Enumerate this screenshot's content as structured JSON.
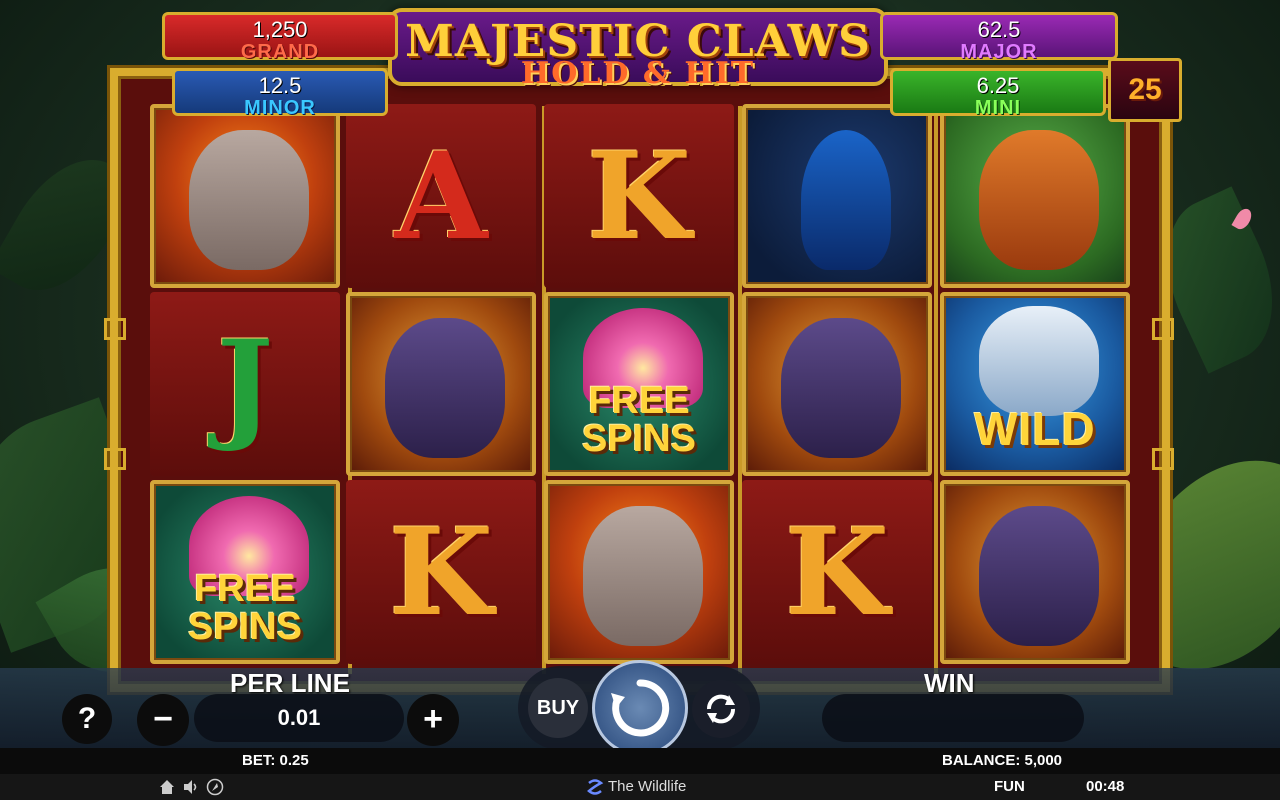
{
  "game": {
    "title": "MAJESTIC CLAWS",
    "subtitle": "HOLD & HIT",
    "lines": "25"
  },
  "jackpots": {
    "grand": {
      "amount": "1,250",
      "label": "GRAND"
    },
    "minor": {
      "amount": "12.5",
      "label": "MINOR"
    },
    "major": {
      "amount": "62.5",
      "label": "MAJOR"
    },
    "mini": {
      "amount": "6.25",
      "label": "MINI"
    }
  },
  "reels": [
    [
      "elephant",
      "J",
      "free-spins"
    ],
    [
      "A",
      "bear",
      "K"
    ],
    [
      "K",
      "free-spins",
      "elephant"
    ],
    [
      "peacock",
      "bear",
      "K"
    ],
    [
      "red-panda",
      "wild-tiger",
      "bear"
    ]
  ],
  "symbols": {
    "wild": "WILD",
    "free_line1": "FREE",
    "free_line2": "SPINS",
    "letter_a": "A",
    "letter_k": "K",
    "letter_j": "J"
  },
  "controls": {
    "per_line_label": "PER LINE",
    "per_line_value": "0.01",
    "win_label": "WIN",
    "buy_label": "BUY",
    "help_label": "?",
    "minus_label": "−",
    "plus_label": "+"
  },
  "status": {
    "bet": "BET: 0.25",
    "balance": "BALANCE: 5,000",
    "mode": "FUN",
    "clock": "00:48",
    "brand": "The Wildlife"
  },
  "icons": [
    "home-icon",
    "sound-icon",
    "turbo-icon",
    "spin-icon",
    "autoplay-icon",
    "brand-logo-icon"
  ]
}
